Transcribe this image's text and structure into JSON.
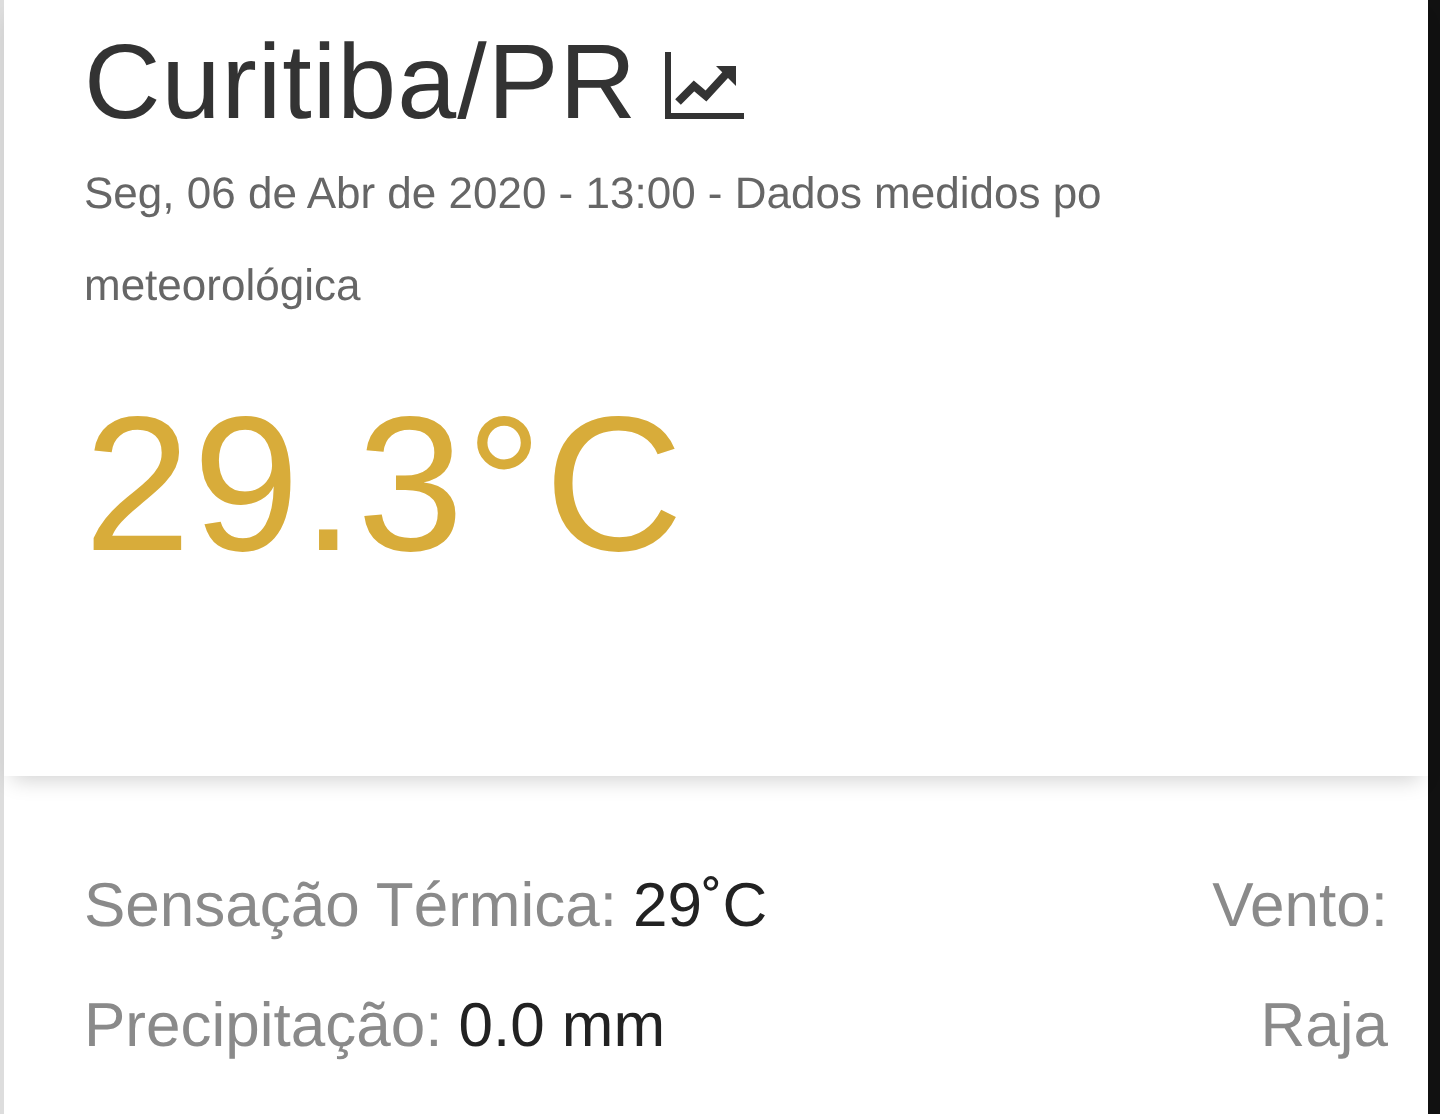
{
  "station": {
    "title": "Curitiba/PR",
    "subtitle_lines": [
      "Seg, 06 de Abr de 2020 - 13:00 - Dados medidos po",
      "meteorológica"
    ],
    "temperature": "29.3°C"
  },
  "stats_left": [
    {
      "label": "Sensação Térmica:",
      "value": "29˚C"
    },
    {
      "label": "Precipitação:",
      "value": "0.0 mm"
    }
  ],
  "stats_right": [
    {
      "label": "Vento:"
    },
    {
      "label": "Raja"
    }
  ]
}
